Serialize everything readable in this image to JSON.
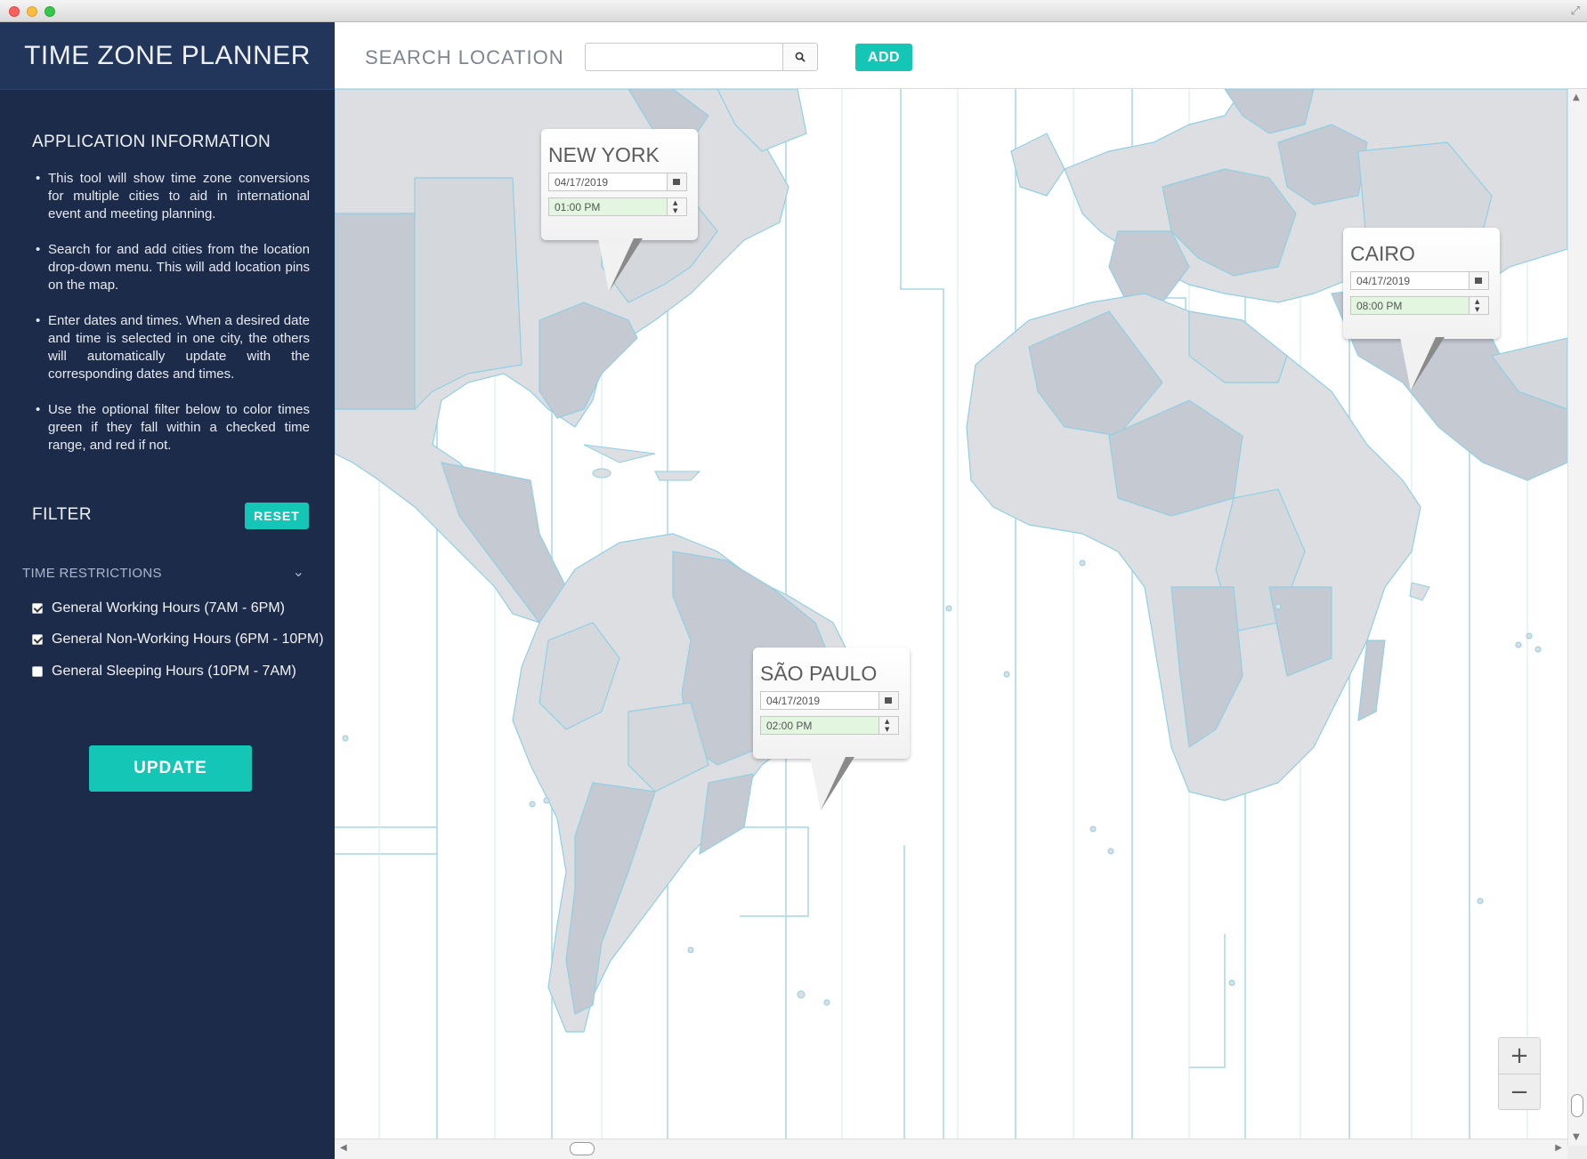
{
  "app": {
    "title": "TIME ZONE PLANNER"
  },
  "info": {
    "title": "APPLICATION INFORMATION",
    "bullets": [
      "This tool will show time zone conversions for multiple cities to aid in international event and meeting planning.",
      "Search for and add cities from the location drop-down menu.  This will add  location pins on the map.",
      "Enter dates and times. When a desired date and time is selected in one city, the others will automatically update with the corresponding dates and times.",
      "Use the optional filter below to color times green if they fall within a checked time range, and red if not."
    ]
  },
  "filter": {
    "title": "FILTER",
    "reset_label": "RESET",
    "section_label": "TIME RESTRICTIONS",
    "options": [
      {
        "label": "General Working Hours (7AM - 6PM)",
        "checked": true
      },
      {
        "label": "General Non-Working Hours (6PM - 10PM)",
        "checked": true
      },
      {
        "label": "General Sleeping Hours (10PM - 7AM)",
        "checked": false
      }
    ],
    "update_label": "UPDATE"
  },
  "search": {
    "label": "SEARCH LOCATION",
    "value": "",
    "placeholder": "",
    "add_label": "ADD"
  },
  "pins": [
    {
      "city": "NEW YORK",
      "date": "04/17/2019",
      "time": "01:00 PM"
    },
    {
      "city": "CAIRO",
      "date": "04/17/2019",
      "time": "08:00 PM"
    },
    {
      "city": "SÃO PAULO",
      "date": "04/17/2019",
      "time": "02:00 PM"
    }
  ],
  "zoom": {
    "in": "+",
    "out": "−"
  },
  "colors": {
    "sidebar": "#1d2b4a",
    "accent": "#14c6b6",
    "land": "#dcdee2",
    "land_dark": "#c5c9d1",
    "zone_line": "#a7d7e6",
    "time_ok": "#e3f7e0"
  },
  "icons": {
    "search": "search-icon",
    "calendar": "calendar-icon",
    "spinner": "spinner-icon",
    "chevron": "chevron-down-icon"
  }
}
